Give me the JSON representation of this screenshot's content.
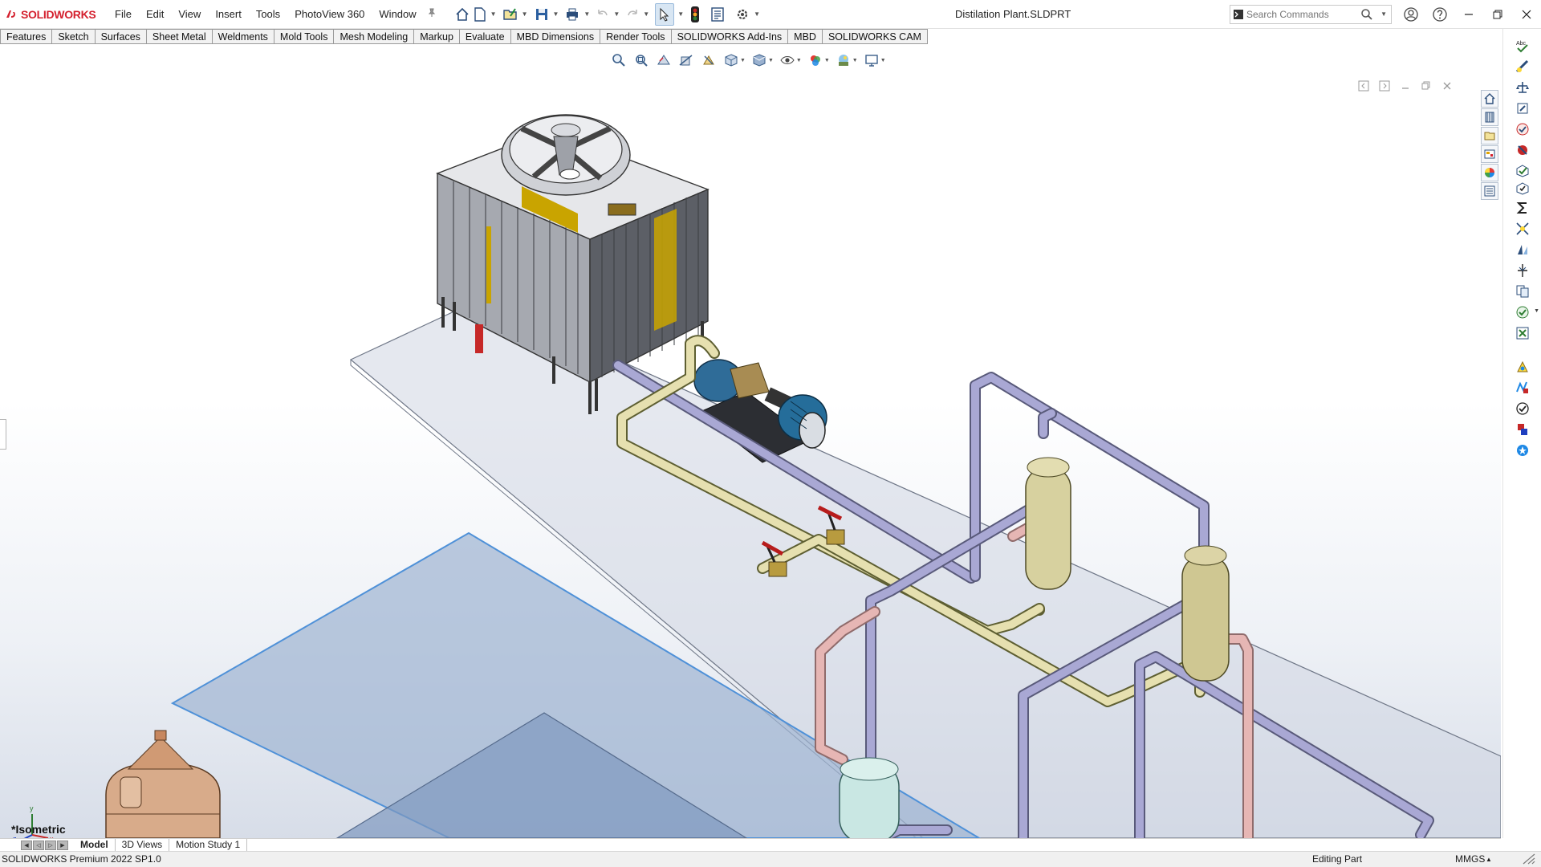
{
  "app": {
    "brand": "SOLIDWORKS",
    "accent": "#d4202e"
  },
  "menu": [
    "File",
    "Edit",
    "View",
    "Insert",
    "Tools",
    "PhotoView 360",
    "Window"
  ],
  "document": {
    "title": "Distilation Plant.SLDPRT"
  },
  "search": {
    "placeholder": "Search Commands"
  },
  "command_tabs": [
    "Features",
    "Sketch",
    "Surfaces",
    "Sheet Metal",
    "Weldments",
    "Mold Tools",
    "Mesh Modeling",
    "Markup",
    "Evaluate",
    "MBD Dimensions",
    "Render Tools",
    "SOLIDWORKS Add-Ins",
    "MBD",
    "SOLIDWORKS CAM"
  ],
  "viewport": {
    "view_orientation": "*Isometric",
    "axes": [
      "x",
      "y",
      "z"
    ]
  },
  "bottom_tabs": [
    "Model",
    "3D Views",
    "Motion Study 1"
  ],
  "status": {
    "product": "SOLIDWORKS Premium 2022 SP1.0",
    "mode": "Editing Part",
    "units": "MMGS"
  },
  "icons": {
    "quick_access": [
      "home-icon",
      "new-document-icon",
      "open-icon",
      "save-icon",
      "print-icon",
      "undo-icon",
      "redo-icon",
      "select-icon",
      "traffic-light-icon",
      "file-properties-icon",
      "options-gear-icon"
    ],
    "heads_up": [
      "zoom-to-fit-icon",
      "zoom-to-area-icon",
      "previous-view-icon",
      "section-view-icon",
      "dynamic-annotation-icon",
      "view-orientation-icon",
      "display-style-icon",
      "hide-show-icon",
      "edit-appearance-icon",
      "apply-scene-icon",
      "view-settings-icon"
    ],
    "task_pane": [
      "home-icon",
      "design-library-icon",
      "file-explorer-icon",
      "view-palette-icon",
      "appearances-icon",
      "custom-properties-icon"
    ],
    "right_toolbar": [
      "smart-dimension-icon",
      "measure-icon",
      "mass-properties-icon",
      "section-properties-icon",
      "check-icon",
      "geometry-analysis-icon",
      "import-diagnosis-icon",
      "equations-icon",
      "deviation-analysis-icon",
      "draft-analysis-icon",
      "symmetry-check-icon",
      "compare-documents-icon",
      "design-checker-icon",
      "delete-face-icon",
      "costing-icon",
      "simulation-xpress-icon",
      "dfmxpress-icon",
      "sustainability-icon",
      "3d-contentcentral-icon"
    ]
  }
}
